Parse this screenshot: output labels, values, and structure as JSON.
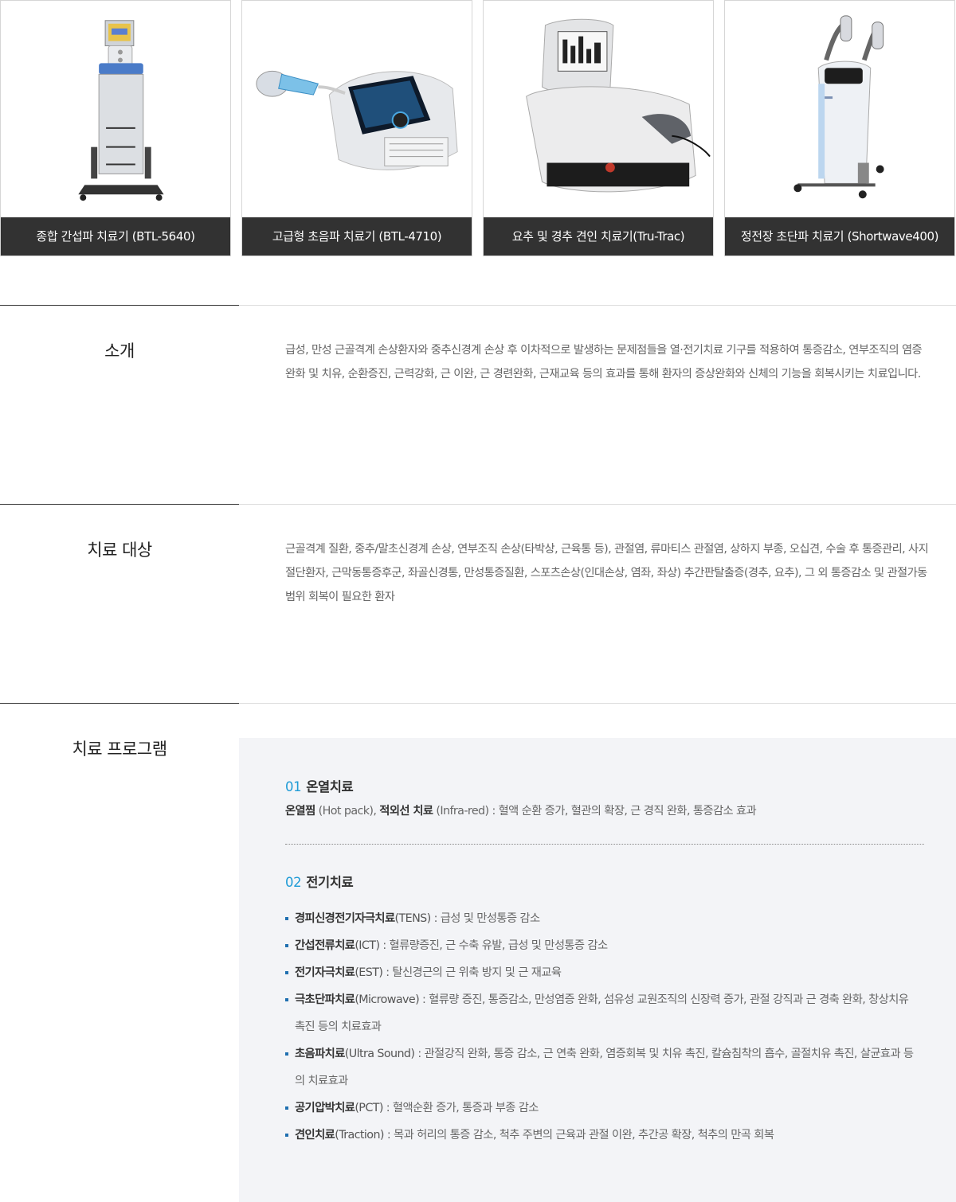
{
  "equipment": [
    {
      "caption": "종합 간섭파 치료기 (BTL-5640)",
      "icon": "interference-therapy-device"
    },
    {
      "caption": "고급형 초음파 치료기 (BTL-4710)",
      "icon": "ultrasound-therapy-device"
    },
    {
      "caption": "요추 및 경추 견인 치료기(Tru-Trac)",
      "icon": "traction-therapy-device"
    },
    {
      "caption": "정전장 초단파 치료기 (Shortwave400)",
      "icon": "shortwave-therapy-device"
    }
  ],
  "intro": {
    "heading": "소개",
    "text": "급성, 만성 근골격계 손상환자와 중추신경계 손상 후 이차적으로 발생하는 문제점들을 열·전기치료 기구를 적용하여 통증감소, 연부조직의 염증완화 및 치유, 순환증진, 근력강화, 근 이완, 근 경련완화, 근재교육 등의 효과를 통해 환자의 증상완화와 신체의 기능을 회복시키는 치료입니다."
  },
  "target": {
    "heading": "치료 대상",
    "text": "근골격계 질환, 중추/말초신경계 손상, 연부조직 손상(타박상, 근육통 등), 관절염, 류마티스 관절염, 상하지 부종, 오십견, 수술 후 통증관리, 사지절단환자, 근막동통증후군, 좌골신경통, 만성통증질환, 스포츠손상(인대손상, 염좌, 좌상) 추간판탈출증(경추, 요추), 그 외 통증감소 및 관절가동범위 회복이 필요한 환자"
  },
  "program": {
    "heading": "치료 프로그램",
    "items": [
      {
        "num": "01",
        "title": "온열치료",
        "desc": {
          "name1": "온열찜",
          "code1": " (Hot pack), ",
          "name2": "적외선 치료",
          "code2": " (Infra-red)",
          "effect": " : 혈액 순환 증가, 혈관의 확장, 근 경직 완화, 통증감소 효과"
        }
      },
      {
        "num": "02",
        "title": "전기치료",
        "list": [
          {
            "name": "경피신경전기자극치료",
            "code": "(TENS)",
            "desc": " : 급성 및 만성통증 감소"
          },
          {
            "name": "간섭전류치료",
            "code": "(ICT)",
            "desc": " : 혈류량증진, 근 수축 유발, 급성 및 만성통증 감소"
          },
          {
            "name": "전기자극치료",
            "code": "(EST)",
            "desc": " : 탈신경근의 근 위축 방지 및 근 재교육"
          },
          {
            "name": "극초단파치료",
            "code": "(Microwave)",
            "desc": " : 혈류량 증진, 통증감소, 만성염증 완화, 섬유성 교원조직의 신장력 증가, 관절 강직과 근 경축 완화, 창상치유 촉진 등의 치료효과"
          },
          {
            "name": "초음파치료",
            "code": "(Ultra Sound)",
            "desc": " : 관절강직 완화, 통증 감소, 근 연축 완화, 염증회복 및 치유 촉진, 칼슘침착의 흡수, 골절치유 촉진, 살균효과 등의 치료효과"
          },
          {
            "name": "공기압박치료",
            "code": "(PCT)",
            "desc": " : 혈액순환 증가, 통증과 부종 감소"
          },
          {
            "name": "견인치료",
            "code": "(Traction)",
            "desc": " : 목과 허리의 통증 감소, 척추 주변의 근육과 관절 이완, 추간공 확장, 척추의 만곡 회복"
          }
        ]
      }
    ]
  }
}
